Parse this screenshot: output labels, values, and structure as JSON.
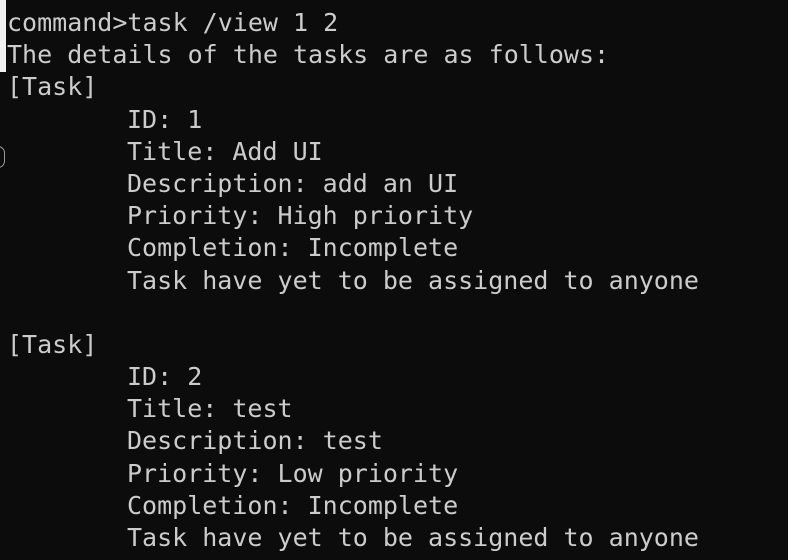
{
  "terminal": {
    "prompt_line": "command>task /view 1 2",
    "intro": "The details of the tasks are as follows:",
    "tasks": [
      {
        "header": "[Task]",
        "id": "ID: 1",
        "title": "Title: Add UI",
        "description": "Description: add an UI",
        "priority": "Priority: High priority",
        "completion": "Completion: Incomplete",
        "assignment": "Task have yet to be assigned to anyone"
      },
      {
        "header": "[Task]",
        "id": "ID: 2",
        "title": "Title: test",
        "description": "Description: test",
        "priority": "Priority: Low priority",
        "completion": "Completion: Incomplete",
        "assignment": "Task have yet to be assigned to anyone"
      }
    ]
  },
  "colors": {
    "background": "#0c0c0c",
    "text": "#cccccc"
  }
}
